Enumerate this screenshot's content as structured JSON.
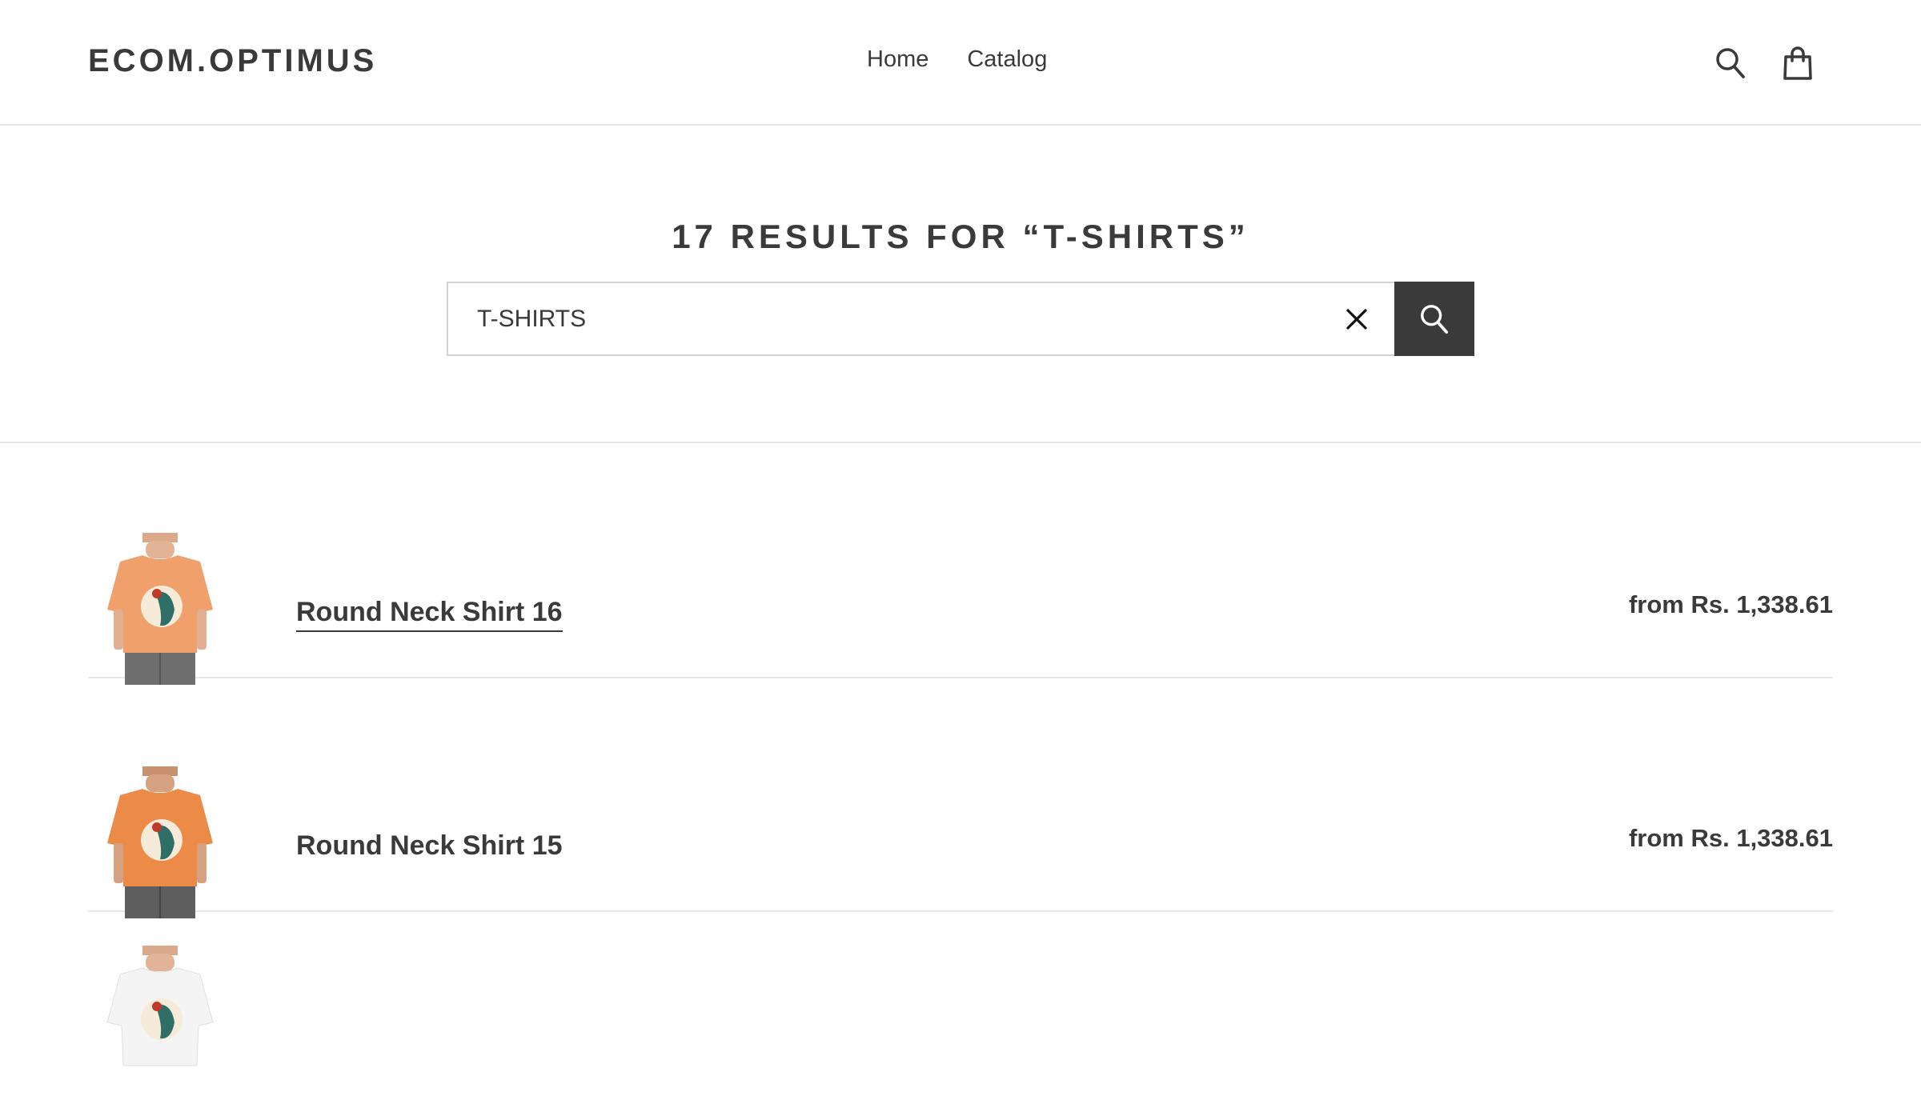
{
  "header": {
    "logo": "ECOM.OPTIMUS",
    "nav": [
      {
        "label": "Home"
      },
      {
        "label": "Catalog"
      }
    ],
    "icons": [
      "search-icon",
      "cart-icon"
    ]
  },
  "search": {
    "title": "17 RESULTS FOR “T-SHIRTS”",
    "query": "T-SHIRTS",
    "clear_icon": "close-icon",
    "submit_icon": "search-icon"
  },
  "results": [
    {
      "title": "Round Neck Shirt 16",
      "price": "from Rs. 1,338.61",
      "shirt_color": "#f0a06a"
    },
    {
      "title": "Round Neck Shirt 15",
      "price": "from Rs. 1,338.61",
      "shirt_color": "#ec8a48"
    },
    {
      "title": "",
      "price": "",
      "shirt_color": "#f4f4f4"
    }
  ],
  "colors": {
    "text": "#3a3a3a",
    "border": "#e8e8e8",
    "button_bg": "#3a3a3a"
  }
}
